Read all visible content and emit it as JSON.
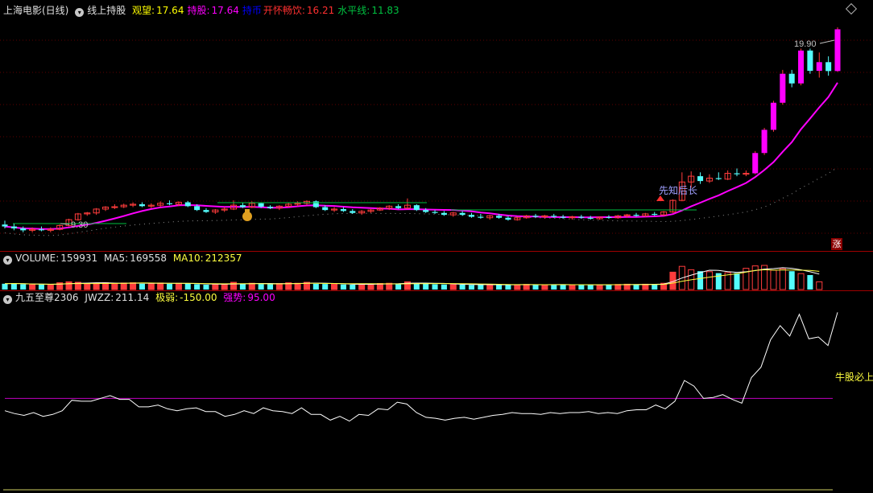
{
  "main": {
    "title": "上海电影(日线)",
    "formula": "线上持股",
    "items": [
      {
        "label": "观望:",
        "value": "17.64",
        "color": "#ffff00"
      },
      {
        "label": "持股:",
        "value": "17.64",
        "color": "#ff00ff"
      },
      {
        "label": "持币",
        "value": "",
        "color": "#0000ff"
      },
      {
        "label": "开怀畅饮:",
        "value": "16.21",
        "color": "#ff3030"
      },
      {
        "label": "水平线:",
        "value": "11.83",
        "color": "#00c040"
      }
    ],
    "high_label": "19.90",
    "low_label": "9.30",
    "annotation": "先知后长",
    "corner_badge": "涨"
  },
  "volume": {
    "label": "VOLUME:",
    "value": "159931",
    "ma5_label": "MA5:",
    "ma5": "169558",
    "ma10_label": "MA10:",
    "ma10": "212357"
  },
  "indicator": {
    "title": "九五至尊2306",
    "jwzz_label": "JWZZ:",
    "jwzz": "211.14",
    "weak_label": "极弱:",
    "weak": "-150.00",
    "strong_label": "强势:",
    "strong": "95.00",
    "line_label": "牛股必上"
  },
  "colors": {
    "up": "#ff3c3c",
    "down": "#54fcfc",
    "ma": "#ff00ff",
    "strong_line": "#c000c0",
    "text_yellow": "#ffff40"
  },
  "chart_data": [
    {
      "type": "candlestick",
      "title": "上海电影(日线)",
      "candles": [
        {
          "o": 9.7,
          "h": 9.9,
          "l": 9.5,
          "c": 9.6
        },
        {
          "o": 9.6,
          "h": 9.75,
          "l": 9.4,
          "c": 9.5
        },
        {
          "o": 9.5,
          "h": 9.6,
          "l": 9.3,
          "c": 9.4
        },
        {
          "o": 9.4,
          "h": 9.55,
          "l": 9.3,
          "c": 9.45
        },
        {
          "o": 9.45,
          "h": 9.6,
          "l": 9.35,
          "c": 9.4
        },
        {
          "o": 9.4,
          "h": 9.55,
          "l": 9.3,
          "c": 9.45
        },
        {
          "o": 9.45,
          "h": 9.7,
          "l": 9.4,
          "c": 9.65
        },
        {
          "o": 9.65,
          "h": 10.0,
          "l": 9.6,
          "c": 9.95
        },
        {
          "o": 9.95,
          "h": 10.3,
          "l": 9.9,
          "c": 10.25
        },
        {
          "o": 10.25,
          "h": 10.35,
          "l": 10.15,
          "c": 10.3
        },
        {
          "o": 10.3,
          "h": 10.55,
          "l": 10.2,
          "c": 10.5
        },
        {
          "o": 10.5,
          "h": 10.65,
          "l": 10.4,
          "c": 10.6
        },
        {
          "o": 10.6,
          "h": 10.75,
          "l": 10.5,
          "c": 10.62
        },
        {
          "o": 10.62,
          "h": 10.78,
          "l": 10.55,
          "c": 10.7
        },
        {
          "o": 10.7,
          "h": 10.85,
          "l": 10.6,
          "c": 10.75
        },
        {
          "o": 10.75,
          "h": 10.85,
          "l": 10.6,
          "c": 10.65
        },
        {
          "o": 10.65,
          "h": 10.8,
          "l": 10.55,
          "c": 10.7
        },
        {
          "o": 10.7,
          "h": 10.9,
          "l": 10.6,
          "c": 10.8
        },
        {
          "o": 10.8,
          "h": 10.95,
          "l": 10.7,
          "c": 10.75
        },
        {
          "o": 10.75,
          "h": 10.9,
          "l": 10.65,
          "c": 10.85
        },
        {
          "o": 10.85,
          "h": 10.92,
          "l": 10.6,
          "c": 10.65
        },
        {
          "o": 10.65,
          "h": 10.75,
          "l": 10.4,
          "c": 10.45
        },
        {
          "o": 10.45,
          "h": 10.55,
          "l": 10.3,
          "c": 10.35
        },
        {
          "o": 10.35,
          "h": 10.5,
          "l": 10.25,
          "c": 10.45
        },
        {
          "o": 10.45,
          "h": 10.6,
          "l": 10.35,
          "c": 10.5
        },
        {
          "o": 10.5,
          "h": 10.95,
          "l": 10.45,
          "c": 10.7
        },
        {
          "o": 10.7,
          "h": 10.85,
          "l": 10.55,
          "c": 10.6
        },
        {
          "o": 10.6,
          "h": 10.9,
          "l": 10.55,
          "c": 10.8
        },
        {
          "o": 10.8,
          "h": 10.85,
          "l": 10.55,
          "c": 10.62
        },
        {
          "o": 10.62,
          "h": 10.7,
          "l": 10.5,
          "c": 10.55
        },
        {
          "o": 10.55,
          "h": 10.7,
          "l": 10.45,
          "c": 10.65
        },
        {
          "o": 10.65,
          "h": 10.85,
          "l": 10.6,
          "c": 10.75
        },
        {
          "o": 10.75,
          "h": 10.9,
          "l": 10.65,
          "c": 10.8
        },
        {
          "o": 10.8,
          "h": 10.95,
          "l": 10.7,
          "c": 10.9
        },
        {
          "o": 10.9,
          "h": 10.95,
          "l": 10.55,
          "c": 10.6
        },
        {
          "o": 10.6,
          "h": 10.7,
          "l": 10.4,
          "c": 10.45
        },
        {
          "o": 10.45,
          "h": 10.6,
          "l": 10.35,
          "c": 10.5
        },
        {
          "o": 10.5,
          "h": 10.6,
          "l": 10.35,
          "c": 10.4
        },
        {
          "o": 10.4,
          "h": 10.5,
          "l": 10.25,
          "c": 10.3
        },
        {
          "o": 10.3,
          "h": 10.45,
          "l": 10.2,
          "c": 10.38
        },
        {
          "o": 10.38,
          "h": 10.5,
          "l": 10.3,
          "c": 10.45
        },
        {
          "o": 10.45,
          "h": 10.6,
          "l": 10.4,
          "c": 10.55
        },
        {
          "o": 10.55,
          "h": 10.7,
          "l": 10.45,
          "c": 10.65
        },
        {
          "o": 10.65,
          "h": 10.75,
          "l": 10.5,
          "c": 10.55
        },
        {
          "o": 10.55,
          "h": 11.05,
          "l": 10.5,
          "c": 10.7
        },
        {
          "o": 10.7,
          "h": 10.75,
          "l": 10.4,
          "c": 10.45
        },
        {
          "o": 10.45,
          "h": 10.55,
          "l": 10.3,
          "c": 10.35
        },
        {
          "o": 10.35,
          "h": 10.45,
          "l": 10.25,
          "c": 10.3
        },
        {
          "o": 10.3,
          "h": 10.4,
          "l": 10.15,
          "c": 10.2
        },
        {
          "o": 10.2,
          "h": 10.35,
          "l": 10.1,
          "c": 10.3
        },
        {
          "o": 10.3,
          "h": 10.4,
          "l": 10.15,
          "c": 10.2
        },
        {
          "o": 10.2,
          "h": 10.3,
          "l": 10.05,
          "c": 10.1
        },
        {
          "o": 10.1,
          "h": 10.25,
          "l": 10.0,
          "c": 10.05
        },
        {
          "o": 10.05,
          "h": 10.2,
          "l": 9.95,
          "c": 10.15
        },
        {
          "o": 10.15,
          "h": 10.25,
          "l": 10.0,
          "c": 10.05
        },
        {
          "o": 10.05,
          "h": 10.15,
          "l": 9.9,
          "c": 9.95
        },
        {
          "o": 9.95,
          "h": 10.1,
          "l": 9.9,
          "c": 10.05
        },
        {
          "o": 10.05,
          "h": 10.2,
          "l": 10.0,
          "c": 10.15
        },
        {
          "o": 10.15,
          "h": 10.25,
          "l": 10.05,
          "c": 10.1
        },
        {
          "o": 10.1,
          "h": 10.2,
          "l": 10.0,
          "c": 10.15
        },
        {
          "o": 10.15,
          "h": 10.25,
          "l": 10.05,
          "c": 10.1
        },
        {
          "o": 10.1,
          "h": 10.2,
          "l": 10.0,
          "c": 10.05
        },
        {
          "o": 10.05,
          "h": 10.15,
          "l": 9.95,
          "c": 10.1
        },
        {
          "o": 10.1,
          "h": 10.2,
          "l": 10.0,
          "c": 10.05
        },
        {
          "o": 10.05,
          "h": 10.15,
          "l": 9.95,
          "c": 10.0
        },
        {
          "o": 10.0,
          "h": 10.12,
          "l": 9.95,
          "c": 10.08
        },
        {
          "o": 10.08,
          "h": 10.18,
          "l": 10.0,
          "c": 10.05
        },
        {
          "o": 10.05,
          "h": 10.2,
          "l": 10.0,
          "c": 10.15
        },
        {
          "o": 10.15,
          "h": 10.25,
          "l": 10.05,
          "c": 10.2
        },
        {
          "o": 10.2,
          "h": 10.3,
          "l": 10.1,
          "c": 10.15
        },
        {
          "o": 10.15,
          "h": 10.3,
          "l": 10.1,
          "c": 10.25
        },
        {
          "o": 10.25,
          "h": 10.35,
          "l": 10.15,
          "c": 10.2
        },
        {
          "o": 10.2,
          "h": 10.4,
          "l": 10.15,
          "c": 10.35
        },
        {
          "o": 10.35,
          "h": 11.0,
          "l": 10.3,
          "c": 10.95
        },
        {
          "o": 10.95,
          "h": 12.4,
          "l": 10.9,
          "c": 11.9
        },
        {
          "o": 11.9,
          "h": 12.45,
          "l": 11.6,
          "c": 12.2
        },
        {
          "o": 12.2,
          "h": 12.4,
          "l": 11.8,
          "c": 11.95
        },
        {
          "o": 11.95,
          "h": 12.3,
          "l": 11.85,
          "c": 12.1
        },
        {
          "o": 12.1,
          "h": 12.4,
          "l": 12.0,
          "c": 12.05
        },
        {
          "o": 12.05,
          "h": 12.5,
          "l": 12.0,
          "c": 12.35
        },
        {
          "o": 12.35,
          "h": 12.6,
          "l": 12.2,
          "c": 12.3
        },
        {
          "o": 12.3,
          "h": 12.5,
          "l": 12.2,
          "c": 12.35
        },
        {
          "o": 12.35,
          "h": 13.5,
          "l": 12.3,
          "c": 13.4
        },
        {
          "o": 13.4,
          "h": 14.7,
          "l": 13.3,
          "c": 14.6
        },
        {
          "o": 14.6,
          "h": 16.1,
          "l": 14.5,
          "c": 16.0
        },
        {
          "o": 16.0,
          "h": 17.7,
          "l": 15.9,
          "c": 17.5
        },
        {
          "o": 17.5,
          "h": 17.7,
          "l": 16.8,
          "c": 17.0
        },
        {
          "o": 17.0,
          "h": 18.8,
          "l": 16.9,
          "c": 18.7
        },
        {
          "o": 18.7,
          "h": 18.8,
          "l": 17.5,
          "c": 17.65
        },
        {
          "o": 17.65,
          "h": 18.6,
          "l": 17.3,
          "c": 18.1
        },
        {
          "o": 18.1,
          "h": 18.4,
          "l": 17.4,
          "c": 17.64
        },
        {
          "o": 17.64,
          "h": 19.9,
          "l": 17.6,
          "c": 19.8
        }
      ],
      "ylim": [
        9.0,
        20.4
      ]
    },
    {
      "type": "bar",
      "title": "VOLUME",
      "values": [
        120,
        130,
        110,
        100,
        105,
        95,
        140,
        160,
        150,
        120,
        130,
        140,
        125,
        135,
        140,
        120,
        125,
        135,
        120,
        130,
        125,
        110,
        100,
        105,
        110,
        150,
        120,
        130,
        115,
        110,
        125,
        140,
        130,
        150,
        120,
        115,
        110,
        105,
        100,
        110,
        115,
        125,
        130,
        120,
        160,
        135,
        120,
        110,
        105,
        110,
        100,
        95,
        100,
        105,
        100,
        95,
        100,
        105,
        100,
        100,
        105,
        100,
        95,
        100,
        95,
        100,
        100,
        105,
        110,
        105,
        110,
        110,
        130,
        360,
        480,
        410,
        380,
        370,
        340,
        350,
        340,
        440,
        490,
        500,
        400,
        430,
        380,
        330,
        300,
        159.931
      ],
      "unit": "thousand"
    },
    {
      "type": "line",
      "title": "九五至尊2306",
      "series": [
        {
          "name": "JWZZ",
          "values": [
            82,
            79,
            77,
            80,
            76,
            78,
            82,
            93,
            92,
            92,
            95,
            98,
            94,
            94,
            86,
            86,
            88,
            84,
            82,
            84,
            85,
            81,
            81,
            76,
            78,
            82,
            79,
            85,
            82,
            81,
            79,
            85,
            78,
            78,
            72,
            76,
            71,
            78,
            77,
            84,
            83,
            91,
            89,
            80,
            75,
            74,
            72,
            74,
            75,
            73,
            75,
            77,
            78,
            80,
            79,
            79,
            78,
            80,
            79,
            80,
            80,
            81,
            79,
            80,
            79,
            82,
            83,
            83,
            88,
            84,
            92,
            114,
            108,
            95,
            96,
            99,
            94,
            90,
            117,
            128,
            157,
            172,
            161,
            184,
            158,
            160,
            151,
            186
          ]
        }
      ],
      "strong_level": 95.0,
      "ylim": [
        0,
        200
      ]
    }
  ]
}
